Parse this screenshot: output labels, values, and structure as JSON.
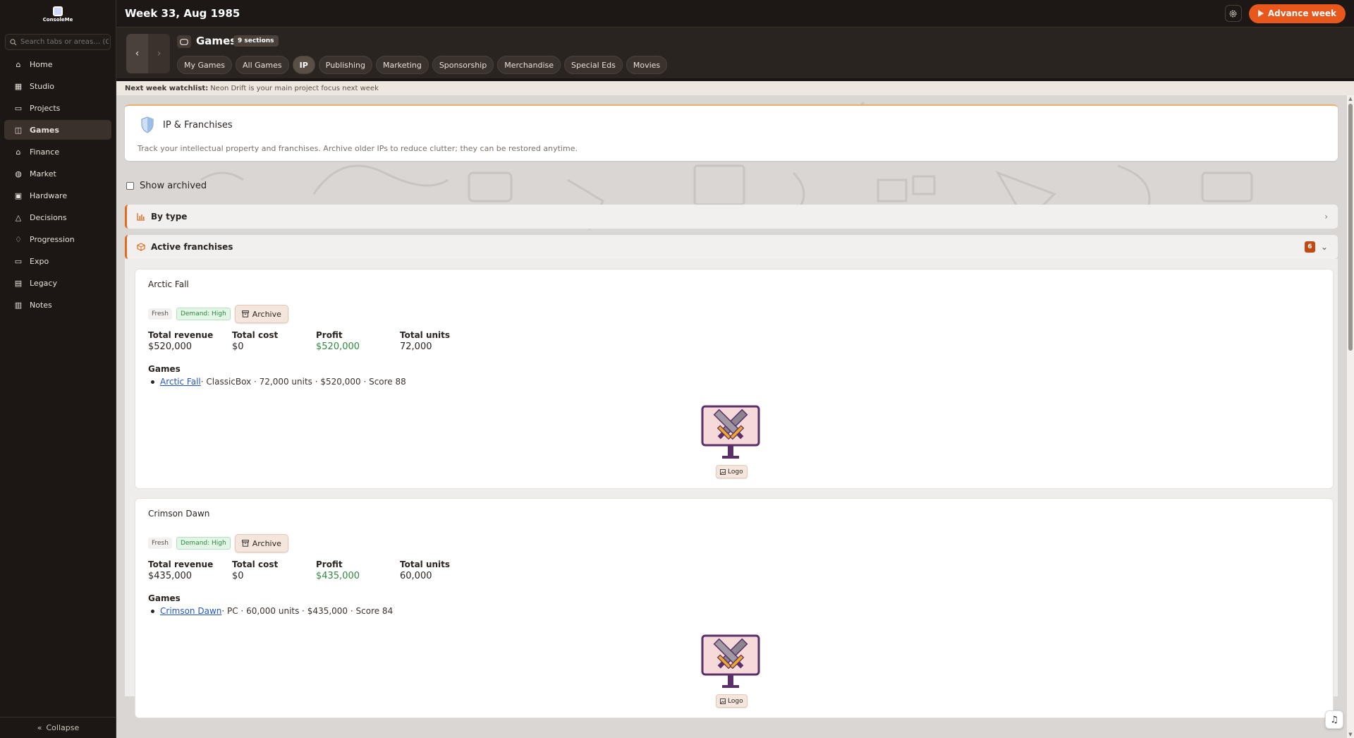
{
  "app": {
    "logo_text": "ConsoleMe"
  },
  "topbar": {
    "title": "Week 33, Aug 1985",
    "advance_label": "Advance week"
  },
  "sidebar": {
    "search_placeholder": "Search tabs or areas… (Ctrl+",
    "items": [
      {
        "label": "Home",
        "icon": "home-icon"
      },
      {
        "label": "Studio",
        "icon": "building-icon"
      },
      {
        "label": "Projects",
        "icon": "folder-icon"
      },
      {
        "label": "Games",
        "icon": "gamepad-icon",
        "active": true
      },
      {
        "label": "Finance",
        "icon": "bank-icon"
      },
      {
        "label": "Market",
        "icon": "globe-icon"
      },
      {
        "label": "Hardware",
        "icon": "chip-icon"
      },
      {
        "label": "Decisions",
        "icon": "triangle-icon"
      },
      {
        "label": "Progression",
        "icon": "bell-icon"
      },
      {
        "label": "Expo",
        "icon": "monitor-icon"
      },
      {
        "label": "Legacy",
        "icon": "film-icon"
      },
      {
        "label": "Notes",
        "icon": "notebook-icon"
      }
    ],
    "collapse_label": "Collapse"
  },
  "section": {
    "title": "Games",
    "badge": "9 sections",
    "tabs": [
      "My Games",
      "All Games",
      "IP",
      "Publishing",
      "Marketing",
      "Sponsorship",
      "Merchandise",
      "Special Eds",
      "Movies"
    ],
    "active_tab": "IP"
  },
  "watchlist": {
    "label": "Next week watchlist:",
    "text": "Neon Drift is your main project focus next week"
  },
  "intro": {
    "title": "IP & Franchises",
    "description": "Track your intellectual property and franchises. Archive older IPs to reduce clutter; they can be restored anytime."
  },
  "show_archived_label": "Show archived",
  "by_type_label": "By type",
  "active_franchises": {
    "label": "Active franchises",
    "count": "6"
  },
  "franchises": [
    {
      "name": "Arctic Fall",
      "fresh": "Fresh",
      "demand": "Demand: High",
      "archive_label": "Archive",
      "stats": [
        {
          "label": "Total revenue",
          "value": "$520,000"
        },
        {
          "label": "Total cost",
          "value": "$0"
        },
        {
          "label": "Profit",
          "value": "$520,000"
        },
        {
          "label": "Total units",
          "value": "72,000"
        }
      ],
      "games_heading": "Games",
      "game_link": "Arctic Fall",
      "game_detail": " · ClassicBox · 72,000 units · $520,000 · Score 88",
      "logo_label": "Logo"
    },
    {
      "name": "Crimson Dawn",
      "fresh": "Fresh",
      "demand": "Demand: High",
      "archive_label": "Archive",
      "stats": [
        {
          "label": "Total revenue",
          "value": "$435,000"
        },
        {
          "label": "Total cost",
          "value": "$0"
        },
        {
          "label": "Profit",
          "value": "$435,000"
        },
        {
          "label": "Total units",
          "value": "60,000"
        }
      ],
      "games_heading": "Games",
      "game_link": "Crimson Dawn",
      "game_detail": " · PC · 60,000 units · $435,000 · Score 84",
      "logo_label": "Logo"
    }
  ],
  "colors": {
    "accent": "#e8571c",
    "profit": "#2e8a3e",
    "link": "#2456c9",
    "badge": "#c24a10"
  }
}
